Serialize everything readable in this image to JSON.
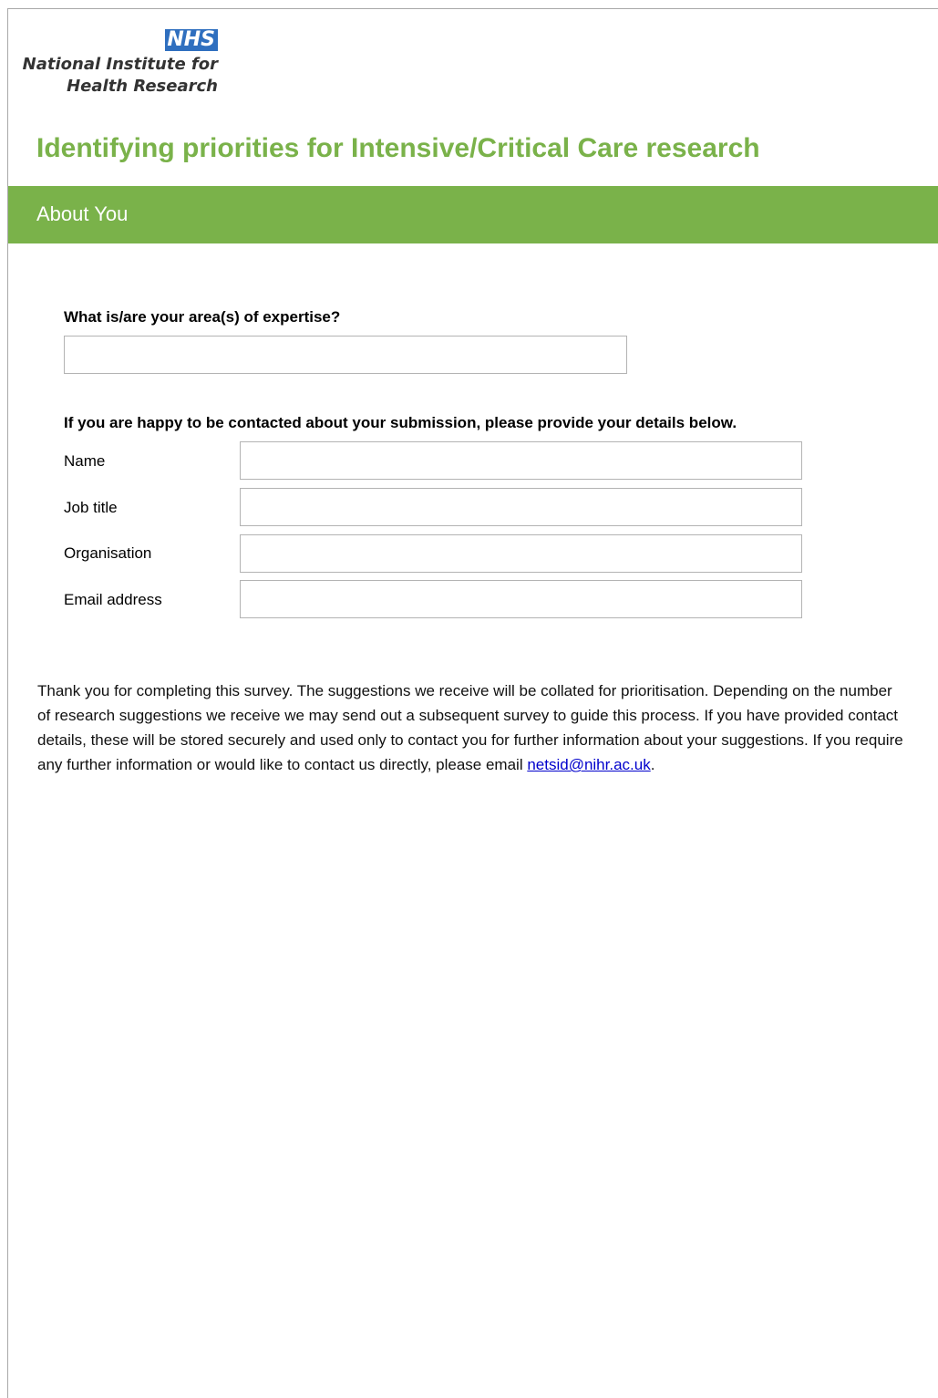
{
  "brand": {
    "badge": "NHS",
    "line1": "National Institute for",
    "line2": "Health Research",
    "badge_color": "#2f6fbf"
  },
  "page": {
    "title": "Identifying priorities for Intensive/Critical Care research",
    "accent_color": "#7ab24a"
  },
  "section": {
    "title": "About You"
  },
  "expertise": {
    "label": "What is/are your area(s) of expertise?",
    "value": ""
  },
  "contact": {
    "intro": "If you are happy to be contacted about your submission, please provide your details below.",
    "fields": [
      {
        "label": "Name",
        "value": ""
      },
      {
        "label": "Job title",
        "value": ""
      },
      {
        "label": "Organisation",
        "value": ""
      },
      {
        "label": "Email address",
        "value": ""
      }
    ]
  },
  "footer": {
    "text": "Thank you for completing this survey. The suggestions we receive will be collated for prioritisation. Depending on the number of research suggestions we receive we may send out a subsequent survey to guide this process. If you have provided contact details, these will be stored securely and used only to contact you for further information about your suggestions. If you require any further information or would like to contact us directly, please email ",
    "email_link": "netsid@nihr.ac.uk",
    "end_punct": "."
  }
}
